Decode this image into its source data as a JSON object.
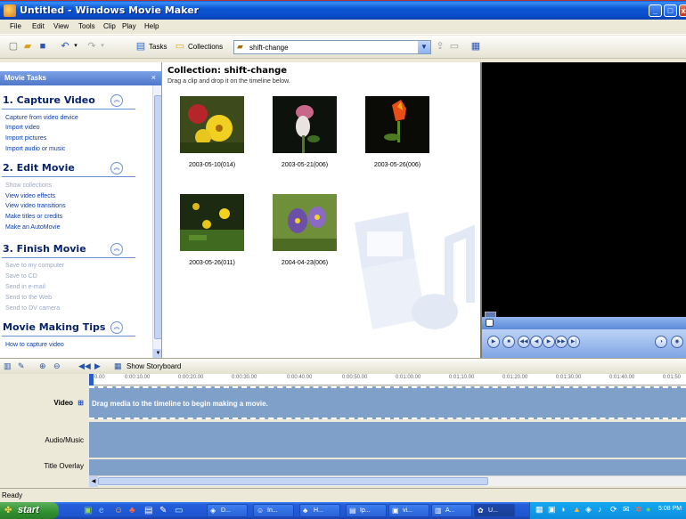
{
  "window": {
    "title": "Untitled - Windows Movie Maker",
    "minimize": "_",
    "maximize": "□",
    "close": "x"
  },
  "menu": [
    "File",
    "Edit",
    "View",
    "Tools",
    "Clip",
    "Play",
    "Help"
  ],
  "toolbar": {
    "tasks_label": "Tasks",
    "collections_label": "Collections",
    "collection_value": "shift-change",
    "icons": [
      "new-project-icon",
      "open-project-icon",
      "save-project-icon",
      "undo-icon",
      "redo-icon",
      "tasks-icon",
      "collections-icon",
      "up-level-icon",
      "new-collection-icon",
      "views-icon"
    ]
  },
  "taskpane": {
    "header": "Movie Tasks",
    "close": "×",
    "sections": [
      {
        "title": "1. Capture Video",
        "links": [
          {
            "label": "Capture from video device",
            "enabled": true
          },
          {
            "label": "Import video",
            "enabled": true
          },
          {
            "label": "Import pictures",
            "enabled": true
          },
          {
            "label": "Import audio or music",
            "enabled": true
          }
        ]
      },
      {
        "title": "2. Edit Movie",
        "links": [
          {
            "label": "Show collections",
            "enabled": false
          },
          {
            "label": "View video effects",
            "enabled": true
          },
          {
            "label": "View video transitions",
            "enabled": true
          },
          {
            "label": "Make titles or credits",
            "enabled": true
          },
          {
            "label": "Make an AutoMovie",
            "enabled": true
          }
        ]
      },
      {
        "title": "3. Finish Movie",
        "links": [
          {
            "label": "Save to my computer",
            "enabled": false
          },
          {
            "label": "Save to CD",
            "enabled": false
          },
          {
            "label": "Send in e-mail",
            "enabled": false
          },
          {
            "label": "Send to the Web",
            "enabled": false
          },
          {
            "label": "Send to DV camera",
            "enabled": false
          }
        ]
      },
      {
        "title": "Movie Making Tips",
        "links": [
          {
            "label": "How to capture video",
            "enabled": true
          }
        ]
      }
    ]
  },
  "collection": {
    "title": "Collection: shift-change",
    "subtitle": "Drag a clip and drop it on the timeline below.",
    "clips": [
      {
        "caption": "2003-05-10(014)"
      },
      {
        "caption": "2003-05-21(006)"
      },
      {
        "caption": "2003-05-26(006)"
      },
      {
        "caption": "2003-05-26(011)"
      },
      {
        "caption": "2004-04-23(006)"
      }
    ]
  },
  "timeline": {
    "show_storyboard": "Show Storyboard",
    "ruler": [
      "0.00",
      "0:00:10.00",
      "0:00:20.00",
      "0:00:30.00",
      "0:00:40.00",
      "0:00:50.00",
      "0:01:00.00",
      "0:01:10.00",
      "0:01:20.00",
      "0:01:30.00",
      "0:01:40.00",
      "0:01:50"
    ],
    "tracks": {
      "video": "Video",
      "audio": "Audio/Music",
      "title": "Title Overlay"
    },
    "hint": "Drag media to the timeline to begin making a movie."
  },
  "status": "Ready",
  "taskbar": {
    "start": "start",
    "buttons": [
      "D...",
      "In...",
      "H...",
      "Ip...",
      "vi...",
      "A...",
      "U..."
    ],
    "clock": "5:08 PM"
  }
}
